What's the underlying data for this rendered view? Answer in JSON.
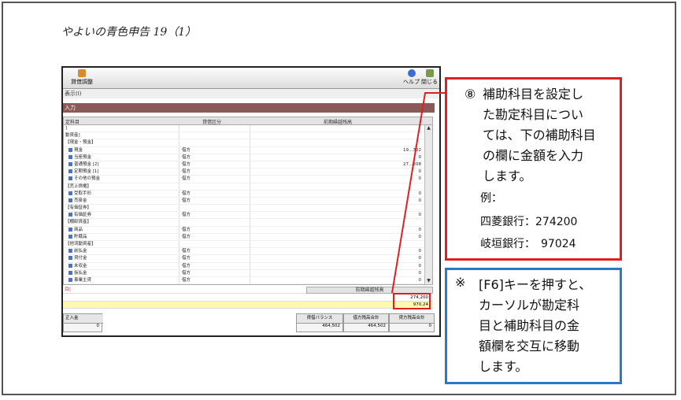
{
  "doc_title": "やよいの青色申告 19（1）",
  "toolbar": {
    "adjust_label": "貸借調整",
    "help_label": "ヘルプ",
    "close_label": "閉じる"
  },
  "subheader": "表示(I)",
  "banner": "入力",
  "grid": {
    "headers": [
      "定科目",
      "貸借区分",
      "前期繰越残高"
    ],
    "rows": [
      {
        "name": "]",
        "side": "",
        "amount": "",
        "kind": "group"
      },
      {
        "name": "動資産]",
        "side": "",
        "amount": "",
        "kind": "group"
      },
      {
        "name": "【現金・預金】",
        "side": "",
        "amount": "",
        "kind": "group"
      },
      {
        "name": "現金",
        "side": "借方",
        "amount": "19…302",
        "kind": "acct"
      },
      {
        "name": "当座預金",
        "side": "借方",
        "amount": "0",
        "kind": "acct"
      },
      {
        "name": "普通預金 [2]",
        "side": "借方",
        "amount": "27…208",
        "kind": "acct"
      },
      {
        "name": "定期預金 [1]",
        "side": "借方",
        "amount": "0",
        "kind": "acct"
      },
      {
        "name": "その他の預金",
        "side": "借方",
        "amount": "0",
        "kind": "acct"
      },
      {
        "name": "【売上債権】",
        "side": "",
        "amount": "",
        "kind": "group"
      },
      {
        "name": "受取手形",
        "side": "借方",
        "amount": "0",
        "kind": "acct"
      },
      {
        "name": "売掛金",
        "side": "借方",
        "amount": "0",
        "kind": "acct"
      },
      {
        "name": "【有価証券】",
        "side": "",
        "amount": "",
        "kind": "group"
      },
      {
        "name": "有価証券",
        "side": "借方",
        "amount": "0",
        "kind": "acct"
      },
      {
        "name": "【棚卸資産】",
        "side": "",
        "amount": "",
        "kind": "group"
      },
      {
        "name": "商品",
        "side": "借方",
        "amount": "0",
        "kind": "acct"
      },
      {
        "name": "貯蔵品",
        "side": "借方",
        "amount": "0",
        "kind": "acct"
      },
      {
        "name": "【他流動資産】",
        "side": "",
        "amount": "",
        "kind": "group"
      },
      {
        "name": "前払金",
        "side": "借方",
        "amount": "0",
        "kind": "acct"
      },
      {
        "name": "貸付金",
        "side": "借方",
        "amount": "0",
        "kind": "acct"
      },
      {
        "name": "未収金",
        "side": "借方",
        "amount": "0",
        "kind": "acct"
      },
      {
        "name": "仮払金",
        "side": "借方",
        "amount": "0",
        "kind": "acct"
      },
      {
        "name": "事業主貸",
        "side": "借方",
        "amount": "0",
        "kind": "acct"
      }
    ]
  },
  "sub_panel": {
    "label": "目]",
    "header": "前期繰越残高",
    "value1": "274,200",
    "value2": "970,24"
  },
  "totals": {
    "left_label": "正入金",
    "left_value": "0",
    "balance_label": "貸借バランス",
    "balance_value": "464,502",
    "debit_label": "借方残高合計",
    "debit_value": "464,502",
    "credit_label": "貸方残高合計",
    "credit_value": "0"
  },
  "callout_red": {
    "number": "⑧",
    "lines": [
      "補助科目を設定し",
      "た勘定科目につい",
      "ては、下の補助科目",
      "の欄に金額を入力",
      "します。"
    ],
    "example_label": "例：",
    "bank1": "四菱銀行：274200",
    "bank2": "岐垣銀行：　97024"
  },
  "callout_blue": {
    "mark": "※",
    "lines": [
      "[F6]キーを押すと、",
      "カーソルが勘定科",
      "目と補助科目の金",
      "額欄を交互に移動",
      "します。"
    ]
  },
  "colors": {
    "red": "#e02020",
    "blue": "#2a78c8",
    "banner": "#8b5a58"
  }
}
